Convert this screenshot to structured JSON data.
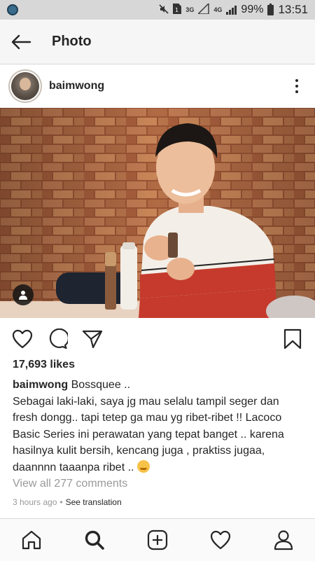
{
  "status_bar": {
    "network_3g": "3G",
    "network_4g": "4G",
    "battery_pct": "99%",
    "time": "13:51",
    "icons": [
      "app-notification-icon",
      "mute-icon",
      "sim-icon",
      "signal-icon",
      "battery-icon"
    ]
  },
  "header": {
    "title": "Photo",
    "back_icon": "arrow-left-icon"
  },
  "post": {
    "username": "baimwong",
    "likes": "17,693 likes",
    "caption_user": "baimwong",
    "caption_first": "Bossquee ..",
    "caption_body": "Sebagai laki-laki, saya jg mau selalu tampil seger dan fresh dongg.. tapi tetep ga mau yg ribet-ribet !! Lacoco Basic Series ini perawatan yang tepat banget .. karena hasilnya kulit bersih, kencang juga , praktiss jugaa, daannnn taaanpa ribet ..",
    "view_comments": "View all 277 comments",
    "time_ago": "3 hours ago",
    "separator": "•",
    "see_translation": "See translation"
  },
  "actions": [
    "heart-icon",
    "comment-icon",
    "share-icon",
    "bookmark-icon"
  ],
  "bottom_nav": [
    "home-icon",
    "search-icon",
    "add-post-icon",
    "activity-heart-icon",
    "profile-icon"
  ],
  "colors": {
    "status_bar_bg": "#d7d7d7",
    "header_bg": "#f6f6f6",
    "text": "#262626",
    "muted": "#9a9a9a"
  }
}
